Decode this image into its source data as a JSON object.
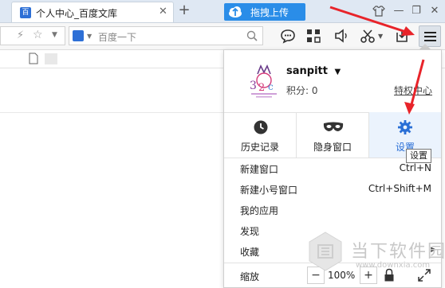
{
  "tab": {
    "title": "个人中心_百度文库",
    "favicon": "百",
    "close": "✕"
  },
  "newtab": "+",
  "upload": {
    "label": "拖拽上传"
  },
  "window_controls": [
    "—",
    "❐",
    "✕"
  ],
  "search": {
    "placeholder": "百度一下"
  },
  "profile": {
    "username": "sanpitt",
    "dropdown": "▼",
    "points": "积分: 0",
    "privilege_link": "特权中心"
  },
  "quick_actions": [
    {
      "label": "历史记录",
      "icon": "clock-icon"
    },
    {
      "label": "隐身窗口",
      "icon": "mask-icon"
    },
    {
      "label": "设置",
      "icon": "gear-icon"
    }
  ],
  "menu_items": [
    {
      "label": "新建窗口",
      "shortcut": "Ctrl+N"
    },
    {
      "label": "新建小号窗口",
      "shortcut": "Ctrl+Shift+M"
    },
    {
      "label": "我的应用",
      "shortcut": ""
    },
    {
      "label": "发现",
      "shortcut": ""
    },
    {
      "label": "收藏",
      "shortcut": ""
    }
  ],
  "zoom": {
    "label": "缩放",
    "minus": "−",
    "value": "100%",
    "plus": "+"
  },
  "tooltip": "设置",
  "watermark": {
    "name": "当下软件园",
    "url": "www.downxia.com"
  },
  "colors": {
    "accent": "#2a8de8",
    "settings_blue": "#2a6fd6",
    "arrow_red": "#e8242a",
    "hover_bg": "#ebf3fd"
  }
}
